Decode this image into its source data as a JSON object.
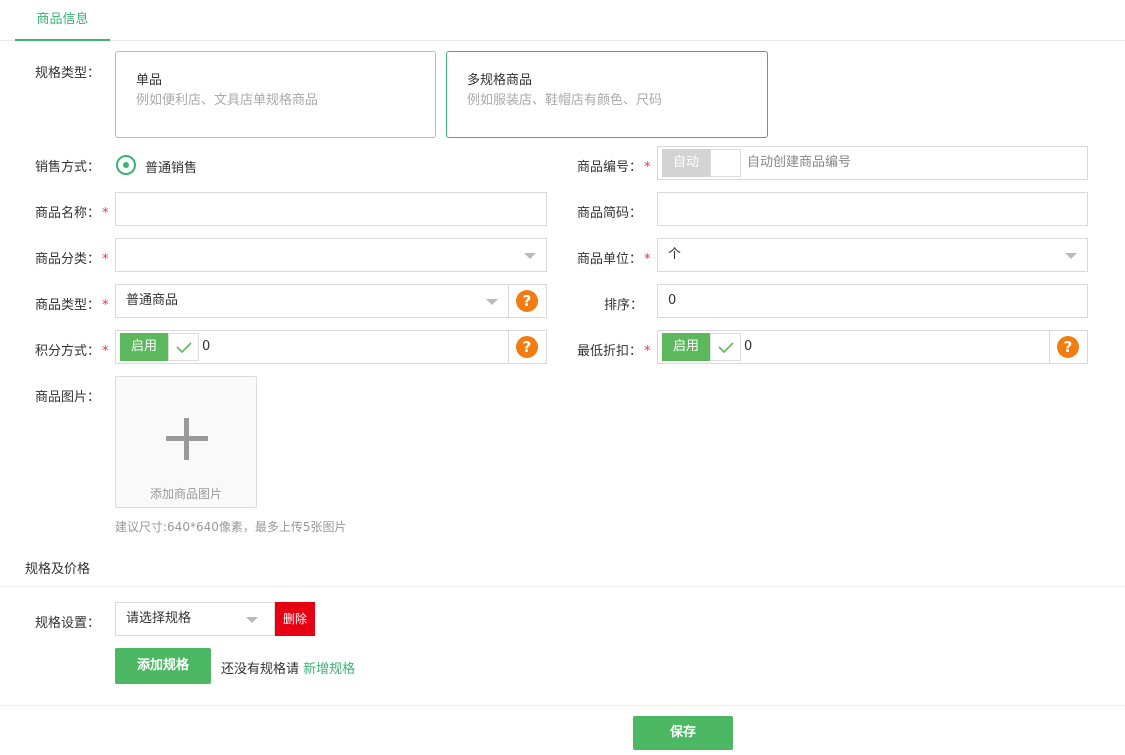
{
  "tab": {
    "label": "商品信息"
  },
  "spec_type": {
    "label": "规格类型：",
    "options": [
      {
        "title": "单品",
        "desc": "例如便利店、文具店单规格商品"
      },
      {
        "title": "多规格商品",
        "desc": "例如服装店、鞋帽店有颜色、尺码"
      }
    ],
    "selected": "多规格商品"
  },
  "sale_mode": {
    "label": "销售方式：",
    "option": "普通销售"
  },
  "product_code": {
    "label": "商品编号：",
    "toggle": "自动",
    "placeholder": "自动创建商品编号"
  },
  "product_name": {
    "label": "商品名称：",
    "value": ""
  },
  "short_code": {
    "label": "商品简码：",
    "value": ""
  },
  "category": {
    "label": "商品分类：",
    "value": ""
  },
  "unit": {
    "label": "商品单位：",
    "value": "个"
  },
  "product_type": {
    "label": "商品类型：",
    "value": "普通商品"
  },
  "sort": {
    "label": "排序：",
    "value": "0"
  },
  "points": {
    "label": "积分方式：",
    "toggle": "启用",
    "value": "0"
  },
  "min_discount": {
    "label": "最低折扣：",
    "toggle": "启用",
    "value": "0"
  },
  "image": {
    "label": "商品图片：",
    "add_label": "添加商品图片",
    "hint": "建议尺寸:640*640像素，最多上传5张图片"
  },
  "spec_price": {
    "section_title": "规格及价格",
    "setting_label": "规格设置：",
    "select_placeholder": "请选择规格",
    "delete_label": "删除",
    "add_button": "添加规格",
    "no_spec_text": "还没有规格请",
    "new_spec_link": "新增规格"
  },
  "save_button": "保存",
  "required_mark": "*",
  "help_mark": "?",
  "colors": {
    "accent": "#3cb371",
    "button": "#4cb863",
    "danger": "#e60012",
    "help": "#f07c12"
  }
}
